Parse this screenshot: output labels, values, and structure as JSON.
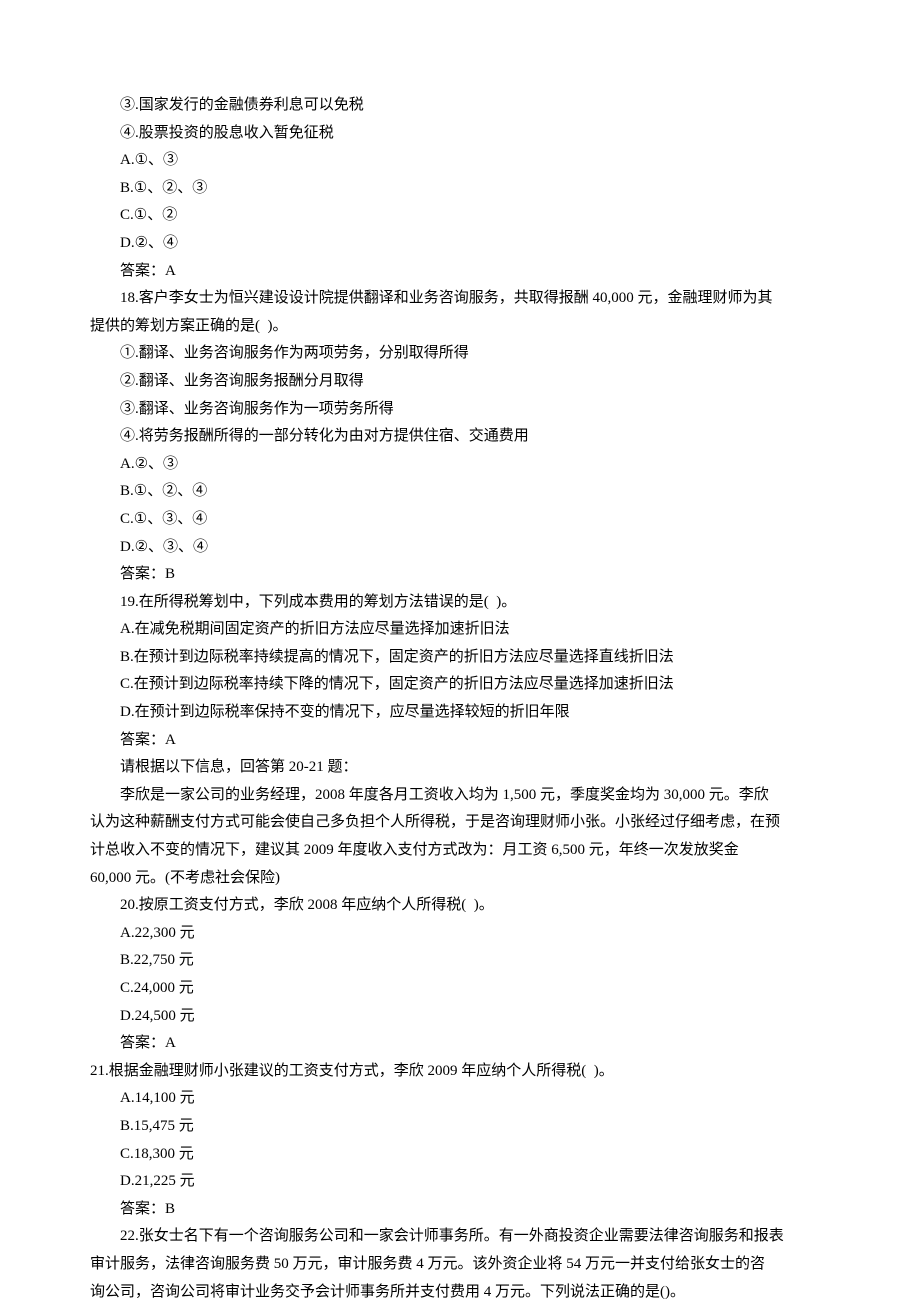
{
  "lines": [
    {
      "cls": "indent",
      "text": "③.国家发行的金融债券利息可以免税"
    },
    {
      "cls": "indent",
      "text": "④.股票投资的股息收入暂免征税"
    },
    {
      "cls": "indent",
      "text": "A.①、③"
    },
    {
      "cls": "indent",
      "text": "B.①、②、③"
    },
    {
      "cls": "indent",
      "text": "C.①、②"
    },
    {
      "cls": "indent",
      "text": "D.②、④"
    },
    {
      "cls": "indent",
      "text": "答案：A"
    },
    {
      "cls": "indent",
      "text": "18.客户李女士为恒兴建设设计院提供翻译和业务咨询服务，共取得报酬 40,000 元，金融理财师为其"
    },
    {
      "cls": "no-indent",
      "text": "提供的筹划方案正确的是(  )。"
    },
    {
      "cls": "indent",
      "text": "①.翻译、业务咨询服务作为两项劳务，分别取得所得"
    },
    {
      "cls": "indent",
      "text": "②.翻译、业务咨询服务报酬分月取得"
    },
    {
      "cls": "indent",
      "text": "③.翻译、业务咨询服务作为一项劳务所得"
    },
    {
      "cls": "indent",
      "text": "④.将劳务报酬所得的一部分转化为由对方提供住宿、交通费用"
    },
    {
      "cls": "indent",
      "text": "A.②、③"
    },
    {
      "cls": "indent",
      "text": "B.①、②、④"
    },
    {
      "cls": "indent",
      "text": "C.①、③、④"
    },
    {
      "cls": "indent",
      "text": "D.②、③、④"
    },
    {
      "cls": "indent",
      "text": "答案：B"
    },
    {
      "cls": "indent",
      "text": "19.在所得税筹划中，下列成本费用的筹划方法错误的是(  )。"
    },
    {
      "cls": "indent",
      "text": "A.在减免税期间固定资产的折旧方法应尽量选择加速折旧法"
    },
    {
      "cls": "indent",
      "text": "B.在预计到边际税率持续提高的情况下，固定资产的折旧方法应尽量选择直线折旧法"
    },
    {
      "cls": "indent",
      "text": "C.在预计到边际税率持续下降的情况下，固定资产的折旧方法应尽量选择加速折旧法"
    },
    {
      "cls": "indent",
      "text": "D.在预计到边际税率保持不变的情况下，应尽量选择较短的折旧年限"
    },
    {
      "cls": "indent",
      "text": "答案：A"
    },
    {
      "cls": "indent",
      "text": "请根据以下信息，回答第 20-21 题："
    },
    {
      "cls": "indent",
      "text": "李欣是一家公司的业务经理，2008 年度各月工资收入均为 1,500 元，季度奖金均为 30,000 元。李欣"
    },
    {
      "cls": "no-indent",
      "text": "认为这种薪酬支付方式可能会使自己多负担个人所得税，于是咨询理财师小张。小张经过仔细考虑，在预"
    },
    {
      "cls": "no-indent",
      "text": "计总收入不变的情况下，建议其 2009 年度收入支付方式改为：月工资 6,500 元，年终一次发放奖金 "
    },
    {
      "cls": "no-indent",
      "text": "60,000 元。(不考虑社会保险)"
    },
    {
      "cls": "indent",
      "text": "20.按原工资支付方式，李欣 2008 年应纳个人所得税(  )。"
    },
    {
      "cls": "indent",
      "text": "A.22,300 元"
    },
    {
      "cls": "indent",
      "text": "B.22,750 元"
    },
    {
      "cls": "indent",
      "text": "C.24,000 元"
    },
    {
      "cls": "indent",
      "text": "D.24,500 元"
    },
    {
      "cls": "indent",
      "text": "答案：A"
    },
    {
      "cls": "no-indent",
      "text": "21.根据金融理财师小张建议的工资支付方式，李欣 2009 年应纳个人所得税(  )。"
    },
    {
      "cls": "indent",
      "text": "A.14,100 元"
    },
    {
      "cls": "indent",
      "text": "B.15,475 元"
    },
    {
      "cls": "indent",
      "text": "C.18,300 元"
    },
    {
      "cls": "indent",
      "text": "D.21,225 元"
    },
    {
      "cls": "indent",
      "text": "答案：B"
    },
    {
      "cls": "indent",
      "text": "22.张女士名下有一个咨询服务公司和一家会计师事务所。有一外商投资企业需要法律咨询服务和报表"
    },
    {
      "cls": "no-indent",
      "text": "审计服务，法律咨询服务费 50 万元，审计服务费 4 万元。该外资企业将 54 万元一并支付给张女士的咨"
    },
    {
      "cls": "no-indent",
      "text": "询公司，咨询公司将审计业务交予会计师事务所并支付费用 4 万元。下列说法正确的是()。"
    }
  ]
}
